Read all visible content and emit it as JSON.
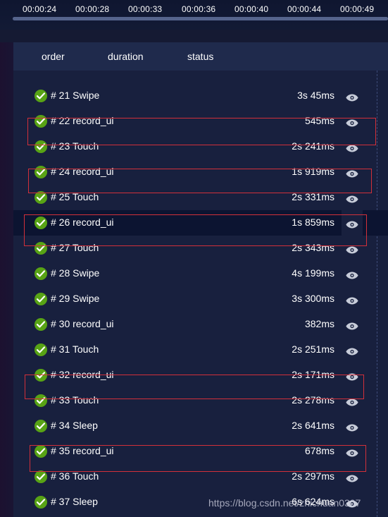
{
  "timeline": {
    "ticks": [
      "00:00:24",
      "00:00:28",
      "00:00:33",
      "00:00:36",
      "00:00:40",
      "00:00:44",
      "00:00:49"
    ]
  },
  "table": {
    "headers": {
      "order": "order",
      "duration": "duration",
      "status": "status"
    },
    "rows": [
      {
        "label": "# 21 Swipe",
        "duration": "3s 45ms"
      },
      {
        "label": "# 22 record_ui",
        "duration": "545ms"
      },
      {
        "label": "# 23 Touch",
        "duration": "2s 241ms"
      },
      {
        "label": "# 24 record_ui",
        "duration": "1s 919ms"
      },
      {
        "label": "# 25 Touch",
        "duration": "2s 331ms"
      },
      {
        "label": "# 26 record_ui",
        "duration": "1s 859ms"
      },
      {
        "label": "# 27 Touch",
        "duration": "2s 343ms"
      },
      {
        "label": "# 28 Swipe",
        "duration": "4s 199ms"
      },
      {
        "label": "# 29 Swipe",
        "duration": "3s 300ms"
      },
      {
        "label": "# 30 record_ui",
        "duration": "382ms"
      },
      {
        "label": "# 31 Touch",
        "duration": "2s 251ms"
      },
      {
        "label": "# 32 record_ui",
        "duration": "2s 171ms"
      },
      {
        "label": "# 33 Touch",
        "duration": "2s 278ms"
      },
      {
        "label": "# 34 Sleep",
        "duration": "2s 641ms"
      },
      {
        "label": "# 35 record_ui",
        "duration": "678ms"
      },
      {
        "label": "# 36 Touch",
        "duration": "2s 297ms"
      },
      {
        "label": "# 37 Sleep",
        "duration": "6s 624ms"
      }
    ],
    "status_icon": "check-circle-icon",
    "action_icon": "eye-icon"
  },
  "watermark": "https://blog.csdn.net/zhichuan0307",
  "colors": {
    "background": "#161b33",
    "panel": "#18203e",
    "header": "#1f2a4c",
    "success": "#58a315",
    "highlight_border": "#d2303a"
  }
}
